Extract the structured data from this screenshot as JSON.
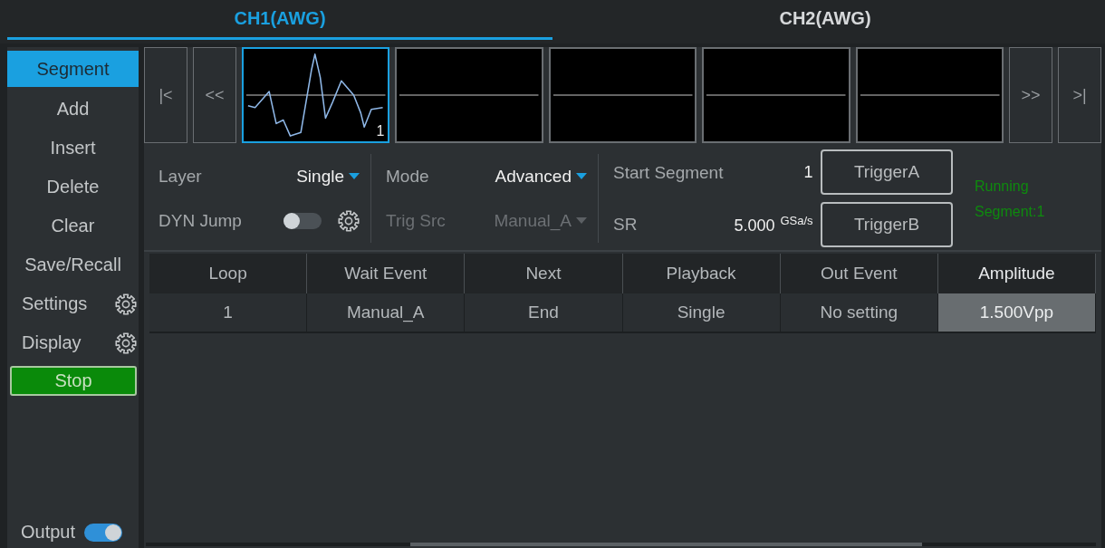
{
  "tabs": [
    {
      "label": "CH1(AWG)",
      "selected": true
    },
    {
      "label": "CH2(AWG)",
      "selected": false
    }
  ],
  "sidebar": {
    "items": [
      {
        "label": "Segment",
        "kind": "item",
        "selected": true
      },
      {
        "label": "Add",
        "kind": "item",
        "selected": false
      },
      {
        "label": "Insert",
        "kind": "item",
        "selected": false
      },
      {
        "label": "Delete",
        "kind": "item",
        "selected": false
      },
      {
        "label": "Clear",
        "kind": "item",
        "selected": false
      },
      {
        "label": "Save/Recall",
        "kind": "item",
        "selected": false
      },
      {
        "label": "Settings",
        "kind": "gear",
        "selected": false
      },
      {
        "label": "Display",
        "kind": "gear",
        "selected": false
      },
      {
        "label": "Stop",
        "kind": "run-button"
      }
    ],
    "output": {
      "label": "Output",
      "on": true
    }
  },
  "segment_strip": {
    "nav_left": [
      "|<",
      "<<"
    ],
    "segments": [
      {
        "kind": "wave",
        "selected": true,
        "label": "1"
      },
      {
        "kind": "flat",
        "selected": false
      },
      {
        "kind": "flat",
        "selected": false
      },
      {
        "kind": "flat",
        "selected": false
      },
      {
        "kind": "flat",
        "selected": false
      }
    ],
    "nav_right": [
      ">>",
      ">|"
    ]
  },
  "controls": {
    "layer": {
      "label": "Layer",
      "value": "Single",
      "disabled": false
    },
    "mode": {
      "label": "Mode",
      "value": "Advanced",
      "disabled": false
    },
    "start_segment": {
      "label": "Start Segment",
      "value": "1"
    },
    "dyn_jump": {
      "label": "DYN Jump",
      "on": false
    },
    "trig_src": {
      "label": "Trig Src",
      "value": "Manual_A",
      "disabled": true
    },
    "sr": {
      "label": "SR",
      "value": "5.000",
      "unit": "GSa/s"
    },
    "buttons": [
      "TriggerA",
      "TriggerB"
    ],
    "status": "Running Segment:1"
  },
  "table": {
    "columns": [
      {
        "label": "Loop",
        "selected": false
      },
      {
        "label": "Wait Event",
        "selected": false
      },
      {
        "label": "Next",
        "selected": false
      },
      {
        "label": "Playback",
        "selected": false
      },
      {
        "label": "Out Event",
        "selected": false
      },
      {
        "label": "Amplitude",
        "selected": true
      }
    ],
    "rows": [
      [
        "1",
        "Manual_A",
        "End",
        "Single",
        "No setting",
        "1.500Vpp"
      ]
    ]
  }
}
